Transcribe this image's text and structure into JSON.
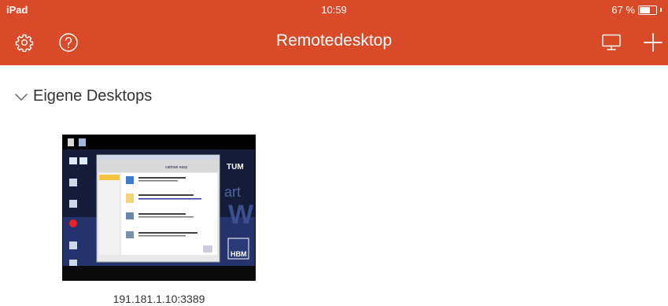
{
  "status_bar": {
    "device": "iPad",
    "time": "10:59",
    "battery_text": "67 %",
    "battery_level": 0.67
  },
  "nav_bar": {
    "title": "Remotedesktop",
    "left_icons": [
      "gear-icon",
      "help-icon"
    ],
    "right_icons": [
      "monitor-icon",
      "plus-icon"
    ]
  },
  "section": {
    "title": "Eigene Desktops",
    "expanded": true
  },
  "desktops": [
    {
      "address": "191.181.1.10:3389",
      "thumbnail": {
        "app_title": "catman easy",
        "brand": "TUM",
        "logo": "HBM"
      }
    }
  ],
  "colors": {
    "accent": "#d84a28",
    "text": "#333333",
    "background": "#ffffff"
  }
}
